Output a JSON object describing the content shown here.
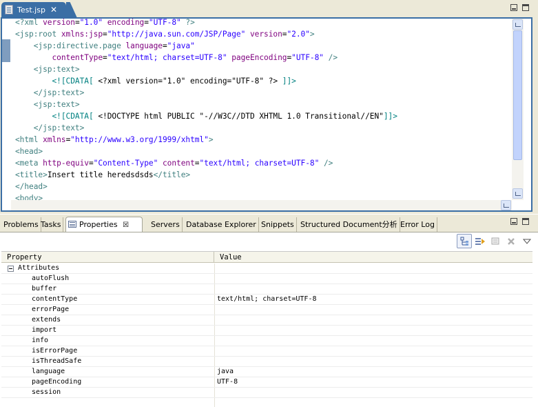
{
  "editor": {
    "tab_label": "Test.jsp",
    "close_glyph": "✕",
    "lines": [
      [
        [
          "tg",
          "<?xml "
        ],
        [
          "at",
          "version"
        ],
        [
          "tx",
          "="
        ],
        [
          "vl",
          "\"1.0\""
        ],
        [
          "tx",
          " "
        ],
        [
          "at",
          "encoding"
        ],
        [
          "tx",
          "="
        ],
        [
          "vl",
          "\"UTF-8\""
        ],
        [
          "tg",
          " ?>"
        ]
      ],
      [
        [
          "tg",
          "<jsp:root "
        ],
        [
          "at",
          "xmlns:jsp"
        ],
        [
          "tx",
          "="
        ],
        [
          "vl",
          "\"http://java.sun.com/JSP/Page\""
        ],
        [
          "tx",
          " "
        ],
        [
          "at",
          "version"
        ],
        [
          "tx",
          "="
        ],
        [
          "vl",
          "\"2.0\""
        ],
        [
          "tg",
          ">"
        ]
      ],
      [
        [
          "tx",
          "    "
        ],
        [
          "tg",
          "<jsp:directive.page "
        ],
        [
          "at",
          "language"
        ],
        [
          "tx",
          "="
        ],
        [
          "vl",
          "\"java\""
        ]
      ],
      [
        [
          "tx",
          "        "
        ],
        [
          "at",
          "contentType"
        ],
        [
          "tx",
          "="
        ],
        [
          "vl",
          "\"text/html; charset=UTF-8\""
        ],
        [
          "tx",
          " "
        ],
        [
          "at",
          "pageEncoding"
        ],
        [
          "tx",
          "="
        ],
        [
          "vl",
          "\"UTF-8\""
        ],
        [
          "tg",
          " />"
        ]
      ],
      [
        [
          "tx",
          "    "
        ],
        [
          "tg",
          "<jsp:text>"
        ]
      ],
      [
        [
          "tx",
          "        "
        ],
        [
          "cd",
          "<![CDATA["
        ],
        [
          "tx",
          " <?xml version=\"1.0\" encoding=\"UTF-8\" ?> "
        ],
        [
          "cd",
          "]]>"
        ]
      ],
      [
        [
          "tx",
          "    "
        ],
        [
          "tg",
          "</jsp:text>"
        ]
      ],
      [
        [
          "tx",
          "    "
        ],
        [
          "tg",
          "<jsp:text>"
        ]
      ],
      [
        [
          "tx",
          "        "
        ],
        [
          "cd",
          "<![CDATA["
        ],
        [
          "tx",
          " <!DOCTYPE html PUBLIC \"-//W3C//DTD XHTML 1.0 Transitional//EN\""
        ],
        [
          "cd",
          "]]>"
        ]
      ],
      [
        [
          "tx",
          "    "
        ],
        [
          "tg",
          "</jsp:text>"
        ]
      ],
      [
        [
          "tg",
          "<html "
        ],
        [
          "at",
          "xmlns"
        ],
        [
          "tx",
          "="
        ],
        [
          "vl",
          "\"http://www.w3.org/1999/xhtml\""
        ],
        [
          "tg",
          ">"
        ]
      ],
      [
        [
          "tg",
          "<head>"
        ]
      ],
      [
        [
          "tg",
          "<meta "
        ],
        [
          "at",
          "http-equiv"
        ],
        [
          "tx",
          "="
        ],
        [
          "vl",
          "\"Content-Type\""
        ],
        [
          "tx",
          " "
        ],
        [
          "at",
          "content"
        ],
        [
          "tx",
          "="
        ],
        [
          "vl",
          "\"text/html; charset=UTF-8\""
        ],
        [
          "tg",
          " />"
        ]
      ],
      [
        [
          "tg",
          "<title>"
        ],
        [
          "tx",
          "Insert title heredsdsds"
        ],
        [
          "tg",
          "</title>"
        ]
      ],
      [
        [
          "tg",
          "</head>"
        ]
      ],
      [
        [
          "tg",
          "<body>"
        ]
      ]
    ]
  },
  "bottom": {
    "tabs": [
      {
        "id": "problems",
        "label": "Problems"
      },
      {
        "id": "tasks",
        "label": "Tasks"
      },
      {
        "id": "properties",
        "label": "Properties"
      },
      {
        "id": "servers",
        "label": "Servers"
      },
      {
        "id": "database-explorer",
        "label": "Database Explorer"
      },
      {
        "id": "snippets",
        "label": "Snippets"
      },
      {
        "id": "structured-document",
        "label": "Structured Document分析"
      },
      {
        "id": "error-log",
        "label": "Error Log"
      }
    ],
    "properties_close_glyph": "☒",
    "toolbar_icons": [
      "categories-icon",
      "advanced-icon",
      "restore-default-icon",
      "delete-icon",
      "view-menu-icon"
    ],
    "table": {
      "col_property": "Property",
      "col_value": "Value",
      "group": "Attributes",
      "rows": [
        {
          "name": "autoFlush",
          "value": ""
        },
        {
          "name": "buffer",
          "value": ""
        },
        {
          "name": "contentType",
          "value": "text/html; charset=UTF-8"
        },
        {
          "name": "errorPage",
          "value": ""
        },
        {
          "name": "extends",
          "value": ""
        },
        {
          "name": "import",
          "value": ""
        },
        {
          "name": "info",
          "value": ""
        },
        {
          "name": "isErrorPage",
          "value": ""
        },
        {
          "name": "isThreadSafe",
          "value": ""
        },
        {
          "name": "language",
          "value": "java"
        },
        {
          "name": "pageEncoding",
          "value": "UTF-8"
        },
        {
          "name": "session",
          "value": ""
        }
      ]
    }
  }
}
